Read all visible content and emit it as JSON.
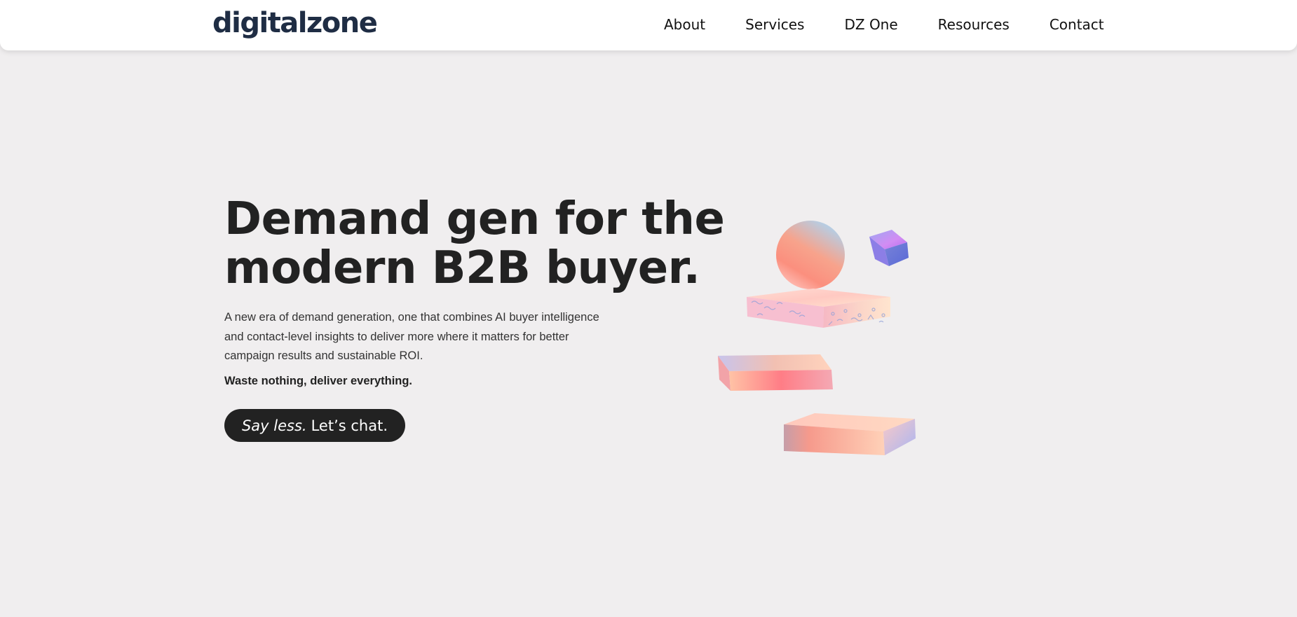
{
  "header": {
    "logo_text": "digitalzone",
    "nav": [
      {
        "label": "About"
      },
      {
        "label": "Services"
      },
      {
        "label": "DZ One"
      },
      {
        "label": "Resources"
      },
      {
        "label": "Contact"
      }
    ]
  },
  "hero": {
    "title_line1": "Demand gen for the",
    "title_line2": "modern B2B buyer.",
    "description_line1": "A new era of demand generation, one that combines AI buyer intelligence",
    "description_line2": "and contact-level insights to deliver more where it matters for better",
    "description_line3": "campaign results and sustainable ROI.",
    "tagline": "Waste nothing, deliver everything.",
    "cta_em": "Say less.",
    "cta_rest": "Let’s chat."
  },
  "colors": {
    "background": "#f0eeef",
    "header_bg": "#ffffff",
    "logo": "#1f2d44",
    "text": "#222222",
    "cta_bg": "#222222",
    "cta_text": "#ffffff"
  },
  "illustration": {
    "icon": "floating-3d-shapes-illustration"
  }
}
